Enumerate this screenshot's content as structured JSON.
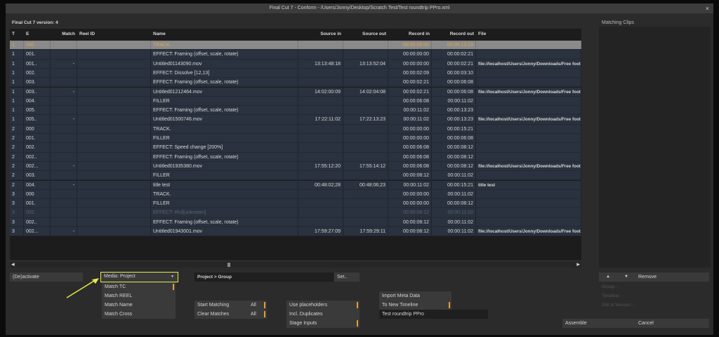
{
  "window": {
    "title": "Final Cut 7 - Conform - /Users/Jonny/Desktop/Scratch Test/Test roundtrip PPro.xml",
    "close": "×"
  },
  "version_label": "Final Cut 7 version: 4",
  "columns": [
    "T",
    "E",
    "Match",
    "Reel ID",
    "Name",
    "Source in",
    "Source out",
    "Record in",
    "Record out",
    "File"
  ],
  "rows": [
    [
      "1",
      "000",
      "",
      "",
      "TRACK.",
      "",
      "",
      "00:00:00:00",
      "00:00:13:23",
      "",
      "sel"
    ],
    [
      "1",
      "001.",
      "",
      "",
      "EFFECT: Framing (offset, scale, rotate)",
      "",
      "",
      "00:00:00:00",
      "00:00:02:21",
      ""
    ],
    [
      "1",
      "001..",
      "-",
      "",
      "Untitled01143090.mov",
      "13:13:48:18",
      "13:13:52:04",
      "00:00:00:00",
      "00:00:02:21",
      "file://localhost/Users/Jonny/Downloads/Free footage"
    ],
    [
      "1",
      "002.",
      "",
      "",
      "EFFECT: Dissolve [12,13]",
      "",
      "",
      "00:00:02:09",
      "00:00:03:10",
      ""
    ],
    [
      "1",
      "003.",
      "",
      "",
      "EFFECT: Framing (offset, scale, rotate)",
      "",
      "",
      "00:00:02:21",
      "00:00:06:08",
      ""
    ],
    [
      "1",
      "003..",
      "-",
      "",
      "Untitled01212464.mov",
      "14:02:00:09",
      "14:02:04:08",
      "00:00:02:21",
      "00:00:06:08",
      "file://localhost/Users/Jonny/Downloads/Free footage"
    ],
    [
      "1",
      "004.",
      "",
      "",
      "FILLER",
      "",
      "",
      "00:00:06:08",
      "00:00:11:02",
      ""
    ],
    [
      "1",
      "005.",
      "",
      "",
      "EFFECT: Framing (offset, scale, rotate)",
      "",
      "",
      "00:00:11:02",
      "00:00:13:23",
      ""
    ],
    [
      "1",
      "005..",
      "-",
      "",
      "Untitled01500746.mov",
      "17:22:11:02",
      "17:22:13:23",
      "00:00:11:02",
      "00:00:13:23",
      "file://localhost/Users/Jonny/Downloads/Free footage"
    ],
    [
      "2",
      "000",
      "",
      "",
      "TRACK.",
      "",
      "",
      "00:00:00:00",
      "00:00:15:21",
      ""
    ],
    [
      "2",
      "001.",
      "",
      "",
      "FILLER",
      "",
      "",
      "00:00:00:00",
      "00:00:06:08",
      ""
    ],
    [
      "2",
      "002.",
      "",
      "",
      "EFFECT: Speed change [200%]",
      "",
      "",
      "00:00:06:08",
      "00:00:08:12",
      ""
    ],
    [
      "2",
      "002..",
      "",
      "",
      "EFFECT: Framing (offset, scale, rotate)",
      "",
      "",
      "00:00:06:08",
      "00:00:08:12",
      ""
    ],
    [
      "2",
      "002...",
      "-",
      "",
      "Untitled01935380.mov",
      "17:55:12:20",
      "17:55:14:12",
      "00:00:06:08",
      "00:00:08:12",
      "file://localhost/Users/Jonny/Downloads/Free footage"
    ],
    [
      "2",
      "003.",
      "",
      "",
      "FILLER",
      "",
      "",
      "00:00:08:12",
      "00:00:11:02",
      ""
    ],
    [
      "2",
      "004.",
      "-",
      "",
      "title test",
      "00:48:02;28",
      "00:48:06;23",
      "00:00:11:02",
      "00:00:15:21",
      "title test"
    ],
    [
      "3",
      "000",
      "",
      "",
      "TRACK.",
      "",
      "",
      "00:00:00:00",
      "00:00:11:02",
      ""
    ],
    [
      "3",
      "001.",
      "",
      "",
      "FILLER",
      "",
      "",
      "00:00:00:00",
      "00:00:08:12",
      ""
    ],
    [
      "3",
      "002.",
      "",
      "",
      "EFFECT: #full[unknown]",
      "",
      "",
      "00:00:08:12",
      "00:00:11:02",
      "",
      "dim"
    ],
    [
      "3",
      "002..",
      "",
      "",
      "EFFECT: Framing (offset, scale, rotate)",
      "",
      "",
      "00:00:08:12",
      "00:00:11:02",
      ""
    ],
    [
      "3",
      "002...",
      "-",
      "",
      "Untitled01943001.mov",
      "17:59:27:09",
      "17:59:29:11",
      "00:00:08:12",
      "00:00:11:02",
      "file://localhost/Users/Jonny/Downloads/Free footage"
    ]
  ],
  "controls": {
    "deactivate": "(De)activate",
    "media_select": "Media: Project",
    "match_options": [
      "Match TC",
      "Match REEL",
      "Match Name",
      "Match Cross"
    ],
    "group_field": "Project > Group",
    "set": "Set..",
    "start_matching": "Start Matching",
    "clear_matches": "Clear Matches",
    "all": "All",
    "use_placeholders": "Use placeholders",
    "incl_duplicates": "Incl. Duplicates",
    "stage_inputs": "Stage Inputs",
    "import_meta": "Import Meta Data",
    "to_new_timeline": "To New Timeline",
    "timeline_name": "Test roundtrip PPro",
    "assemble": "Assemble",
    "cancel": "Cancel"
  },
  "right_panel": {
    "title": "Matching Clips",
    "up": "▲",
    "down": "▼",
    "remove": "Remove",
    "group": "Group: -",
    "timeline": "Timeline: -",
    "slot": "Slot & Version: -"
  },
  "colors": {
    "accent": "#e0a030",
    "highlight": "#e8e84a"
  }
}
